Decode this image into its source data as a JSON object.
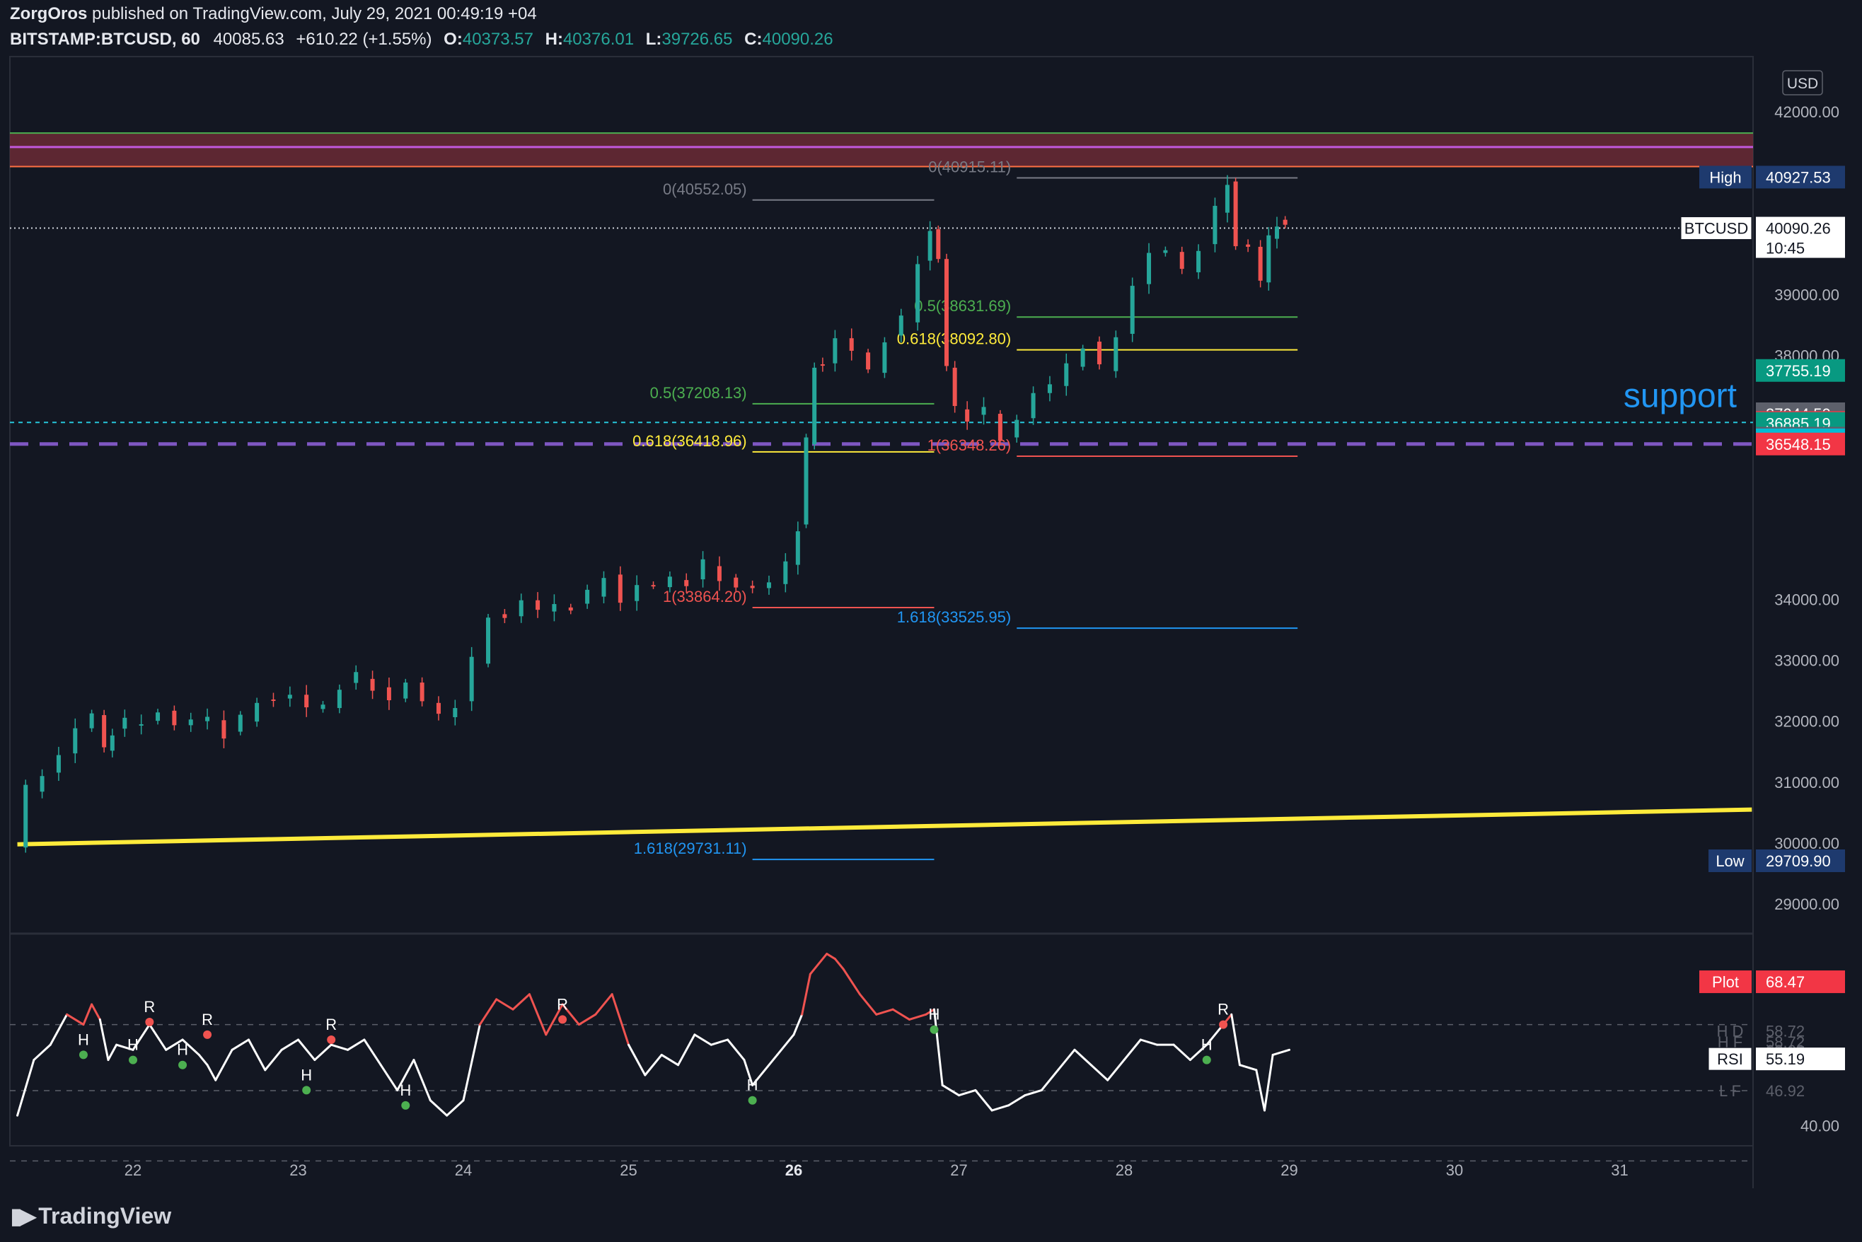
{
  "header": {
    "author": "ZorgOros",
    "published": "published on TradingView.com, July 29, 2021 00:49:19 +04",
    "symbol": "BITSTAMP:BTCUSD, 60",
    "last": "40085.63",
    "change": "+610.22 (+1.55%)",
    "o_label": "O:",
    "o": "40373.57",
    "h_label": "H:",
    "h": "40376.01",
    "l_label": "L:",
    "l": "39726.65",
    "c_label": "C:",
    "c": "40090.26"
  },
  "currency": "USD",
  "logo_text": "TradingView",
  "colors": {
    "background": "#131722",
    "up": "#26a69a",
    "down": "#ef5350",
    "rsi": "#ffffff",
    "yellow": "#ffeb3b",
    "purple": "#7e57c2",
    "cyan": "#26c6da",
    "blue": "#2196f3"
  },
  "chart_data": [
    {
      "type": "candlestick",
      "title": "",
      "x_labels": [
        "22",
        "23",
        "24",
        "25",
        "26",
        "27",
        "28",
        "29",
        "30",
        "31"
      ],
      "y_ticks": [
        29000,
        30000,
        31000,
        32000,
        33000,
        34000,
        38000,
        39000,
        42000
      ],
      "y_tick_labels": [
        "29000.00",
        "30000.00",
        "31000.00",
        "32000.00",
        "33000.00",
        "34000.00",
        "38000.00",
        "39000.00",
        "42000.00"
      ],
      "ylim": [
        28560,
        42600
      ],
      "price_path": [
        [
          21.3,
          29900
        ],
        [
          21.4,
          30900
        ],
        [
          21.5,
          31100
        ],
        [
          21.6,
          31500
        ],
        [
          21.7,
          31800
        ],
        [
          21.8,
          32100
        ],
        [
          21.85,
          31600
        ],
        [
          21.9,
          31850
        ],
        [
          22.0,
          32000
        ],
        [
          22.1,
          31950
        ],
        [
          22.2,
          32200
        ],
        [
          22.3,
          31850
        ],
        [
          22.4,
          32000
        ],
        [
          22.5,
          32100
        ],
        [
          22.6,
          31800
        ],
        [
          22.7,
          32050
        ],
        [
          22.8,
          32300
        ],
        [
          22.9,
          32400
        ],
        [
          23.0,
          32350
        ],
        [
          23.1,
          32200
        ],
        [
          23.2,
          32300
        ],
        [
          23.3,
          32600
        ],
        [
          23.4,
          32750
        ],
        [
          23.5,
          32500
        ],
        [
          23.6,
          32400
        ],
        [
          23.7,
          32550
        ],
        [
          23.8,
          32300
        ],
        [
          23.9,
          32150
        ],
        [
          24.0,
          32300
        ],
        [
          24.1,
          33000
        ],
        [
          24.2,
          33700
        ],
        [
          24.3,
          33750
        ],
        [
          24.4,
          33900
        ],
        [
          24.5,
          33800
        ],
        [
          24.6,
          33950
        ],
        [
          24.7,
          33900
        ],
        [
          24.8,
          34100
        ],
        [
          24.9,
          34350
        ],
        [
          25.0,
          34000
        ],
        [
          25.1,
          34150
        ],
        [
          25.2,
          34200
        ],
        [
          25.3,
          34400
        ],
        [
          25.4,
          34300
        ],
        [
          25.5,
          34600
        ],
        [
          25.6,
          34300
        ],
        [
          25.7,
          34250
        ],
        [
          25.8,
          34100
        ],
        [
          25.9,
          34250
        ],
        [
          26.0,
          34650
        ],
        [
          26.05,
          35200
        ],
        [
          26.1,
          36600
        ],
        [
          26.15,
          37800
        ],
        [
          26.2,
          37900
        ],
        [
          26.3,
          38200
        ],
        [
          26.4,
          38050
        ],
        [
          26.5,
          37800
        ],
        [
          26.6,
          38300
        ],
        [
          26.7,
          38600
        ],
        [
          26.8,
          39500
        ],
        [
          26.85,
          40100
        ],
        [
          26.9,
          39500
        ],
        [
          26.95,
          37800
        ],
        [
          27.0,
          37200
        ],
        [
          27.1,
          37000
        ],
        [
          27.2,
          37100
        ],
        [
          27.3,
          36600
        ],
        [
          27.4,
          37000
        ],
        [
          27.5,
          37300
        ],
        [
          27.6,
          37500
        ],
        [
          27.7,
          37900
        ],
        [
          27.8,
          38200
        ],
        [
          27.9,
          37800
        ],
        [
          28.0,
          38300
        ],
        [
          28.1,
          39200
        ],
        [
          28.2,
          39600
        ],
        [
          28.3,
          39700
        ],
        [
          28.4,
          39450
        ],
        [
          28.5,
          39800
        ],
        [
          28.6,
          40400
        ],
        [
          28.65,
          40800
        ],
        [
          28.7,
          39850
        ],
        [
          28.8,
          39700
        ],
        [
          28.85,
          39200
        ],
        [
          28.9,
          40000
        ],
        [
          28.95,
          40200
        ],
        [
          29.0,
          40090
        ]
      ],
      "price_labels": [
        {
          "name": "High",
          "value": "40927.53",
          "y": 40927.53,
          "color": "#1e3a6e"
        },
        {
          "name": "BTCUSD",
          "value": "40090.26",
          "sub": "10:45",
          "y": 40090.26,
          "color": "#ffffff"
        },
        {
          "value": "37755.19",
          "y": 37755.19,
          "color": "#089981"
        },
        {
          "value": "37044.50",
          "y": 37044.5,
          "color": "#5d606b"
        },
        {
          "value": "36901.64",
          "y": 36901.64,
          "color": "#f23645"
        },
        {
          "value": "36885.19",
          "y": 36885.19,
          "color": "#089981"
        },
        {
          "value": "36644.35",
          "y": 36644.35,
          "color": "#5d606b"
        },
        {
          "value": "36616.69",
          "y": 36616.69,
          "color": "#00bcd4"
        },
        {
          "value": "36548.15",
          "y": 36548.15,
          "color": "#f23645"
        },
        {
          "name": "Low",
          "value": "29709.90",
          "y": 29709.9,
          "color": "#1e3a6e"
        }
      ],
      "zone": {
        "from": 41650,
        "to": 41100
      },
      "horizontal_lines": [
        {
          "name": "support",
          "value": 36901.64,
          "style": "dotted",
          "color": "#26c6da"
        },
        {
          "name": "purple",
          "value": 36548.15,
          "style": "dashed",
          "color": "#7e57c2"
        }
      ],
      "trendline": {
        "from": [
          21.3,
          29980
        ],
        "to": [
          31.8,
          30550
        ],
        "color": "#ffeb3b"
      },
      "support_label": "support",
      "fib_levels": [
        {
          "label": "0(40552.05)",
          "value": 40552.05,
          "x1": 25.75,
          "x2": 26.85,
          "color": "#787b86"
        },
        {
          "label": "0.5(37208.13)",
          "value": 37208.13,
          "x1": 25.75,
          "x2": 26.85,
          "color": "#4caf50"
        },
        {
          "label": "0.618(36418.96)",
          "value": 36418.96,
          "x1": 25.75,
          "x2": 26.85,
          "color": "#ffeb3b"
        },
        {
          "label": "1(33864.20)",
          "value": 33864.2,
          "x1": 25.75,
          "x2": 26.85,
          "color": "#ef5350"
        },
        {
          "label": "1.618(29731.11)",
          "value": 29731.11,
          "x1": 25.75,
          "x2": 26.85,
          "color": "#2196f3"
        },
        {
          "label": "0(40915.11)",
          "value": 40915.11,
          "x1": 27.35,
          "x2": 29.05,
          "color": "#787b86"
        },
        {
          "label": "0.5(38631.69)",
          "value": 38631.69,
          "x1": 27.35,
          "x2": 29.05,
          "color": "#4caf50"
        },
        {
          "label": "0.618(38092.80)",
          "value": 38092.8,
          "x1": 27.35,
          "x2": 29.05,
          "color": "#ffeb3b"
        },
        {
          "label": "1(36348.26)",
          "value": 36348.26,
          "x1": 27.35,
          "x2": 29.05,
          "color": "#ef5350"
        },
        {
          "label": "1.618(33525.95)",
          "value": 33525.95,
          "x1": 27.35,
          "x2": 29.05,
          "color": "#2196f3"
        }
      ]
    },
    {
      "type": "line",
      "title": "RSI",
      "series": [
        {
          "name": "RSI",
          "values": [
            [
              21.3,
              42
            ],
            [
              21.4,
              53
            ],
            [
              21.5,
              56
            ],
            [
              21.6,
              62
            ],
            [
              21.7,
              60
            ],
            [
              21.75,
              64
            ],
            [
              21.8,
              61
            ],
            [
              21.85,
              53
            ],
            [
              21.9,
              56
            ],
            [
              22.0,
              55
            ],
            [
              22.1,
              60
            ],
            [
              22.2,
              55
            ],
            [
              22.3,
              57
            ],
            [
              22.4,
              54
            ],
            [
              22.45,
              52
            ],
            [
              22.5,
              49
            ],
            [
              22.6,
              55
            ],
            [
              22.7,
              57
            ],
            [
              22.8,
              51
            ],
            [
              22.9,
              55
            ],
            [
              23.0,
              57
            ],
            [
              23.1,
              53
            ],
            [
              23.2,
              56
            ],
            [
              23.3,
              55
            ],
            [
              23.4,
              57
            ],
            [
              23.5,
              52
            ],
            [
              23.6,
              47
            ],
            [
              23.7,
              53
            ],
            [
              23.8,
              45
            ],
            [
              23.9,
              42
            ],
            [
              24.0,
              45
            ],
            [
              24.1,
              60
            ],
            [
              24.2,
              65
            ],
            [
              24.3,
              63
            ],
            [
              24.4,
              66
            ],
            [
              24.5,
              58
            ],
            [
              24.6,
              64
            ],
            [
              24.7,
              60
            ],
            [
              24.8,
              62
            ],
            [
              24.9,
              66
            ],
            [
              25.0,
              56
            ],
            [
              25.1,
              50
            ],
            [
              25.2,
              54
            ],
            [
              25.3,
              52
            ],
            [
              25.4,
              58
            ],
            [
              25.5,
              56
            ],
            [
              25.6,
              57
            ],
            [
              25.7,
              53
            ],
            [
              25.75,
              48
            ],
            [
              25.9,
              54
            ],
            [
              26.0,
              58
            ],
            [
              26.05,
              62
            ],
            [
              26.1,
              70
            ],
            [
              26.2,
              74
            ],
            [
              26.25,
              73
            ],
            [
              26.3,
              71
            ],
            [
              26.4,
              66
            ],
            [
              26.5,
              62
            ],
            [
              26.6,
              63
            ],
            [
              26.7,
              61
            ],
            [
              26.8,
              62
            ],
            [
              26.85,
              63
            ],
            [
              26.9,
              48
            ],
            [
              27.0,
              46
            ],
            [
              27.1,
              47
            ],
            [
              27.2,
              43
            ],
            [
              27.3,
              44
            ],
            [
              27.4,
              46
            ],
            [
              27.5,
              47
            ],
            [
              27.6,
              51
            ],
            [
              27.7,
              55
            ],
            [
              27.8,
              52
            ],
            [
              27.9,
              49
            ],
            [
              28.0,
              53
            ],
            [
              28.1,
              57
            ],
            [
              28.2,
              56
            ],
            [
              28.3,
              56
            ],
            [
              28.4,
              53
            ],
            [
              28.5,
              56
            ],
            [
              28.6,
              60
            ],
            [
              28.65,
              62
            ],
            [
              28.7,
              52
            ],
            [
              28.8,
              51
            ],
            [
              28.85,
              43
            ],
            [
              28.9,
              54
            ],
            [
              29.0,
              55
            ]
          ]
        }
      ],
      "ylim": [
        36,
        78
      ],
      "y_ticks": [
        40
      ],
      "y_tick_labels": [
        "40.00"
      ],
      "right_labels": [
        {
          "name": "Plot",
          "value": "68.47",
          "y": 68.47,
          "color": "#f23645"
        },
        {
          "name": "H D",
          "value": "58.72",
          "y": 58.72,
          "color": ""
        },
        {
          "name": "H F",
          "value": "58.72",
          "y": 56.6,
          "color": ""
        },
        {
          "name": "",
          "value": "60.00",
          "y": 54.9,
          "color": ""
        },
        {
          "name": "RSI",
          "value": "55.19",
          "y": 53.2,
          "color": "#ffffff"
        },
        {
          "name": "L F",
          "value": "46.92",
          "y": 46.92,
          "color": ""
        }
      ],
      "markers_R": [
        [
          22.1,
          60.5
        ],
        [
          22.45,
          58
        ],
        [
          23.2,
          57
        ],
        [
          24.6,
          61
        ],
        [
          28.6,
          60
        ]
      ],
      "markers_H": [
        [
          21.7,
          54
        ],
        [
          22.0,
          53
        ],
        [
          22.3,
          52
        ],
        [
          23.05,
          47
        ],
        [
          23.65,
          44
        ],
        [
          25.75,
          45
        ],
        [
          26.85,
          59
        ],
        [
          28.5,
          53
        ]
      ]
    }
  ]
}
